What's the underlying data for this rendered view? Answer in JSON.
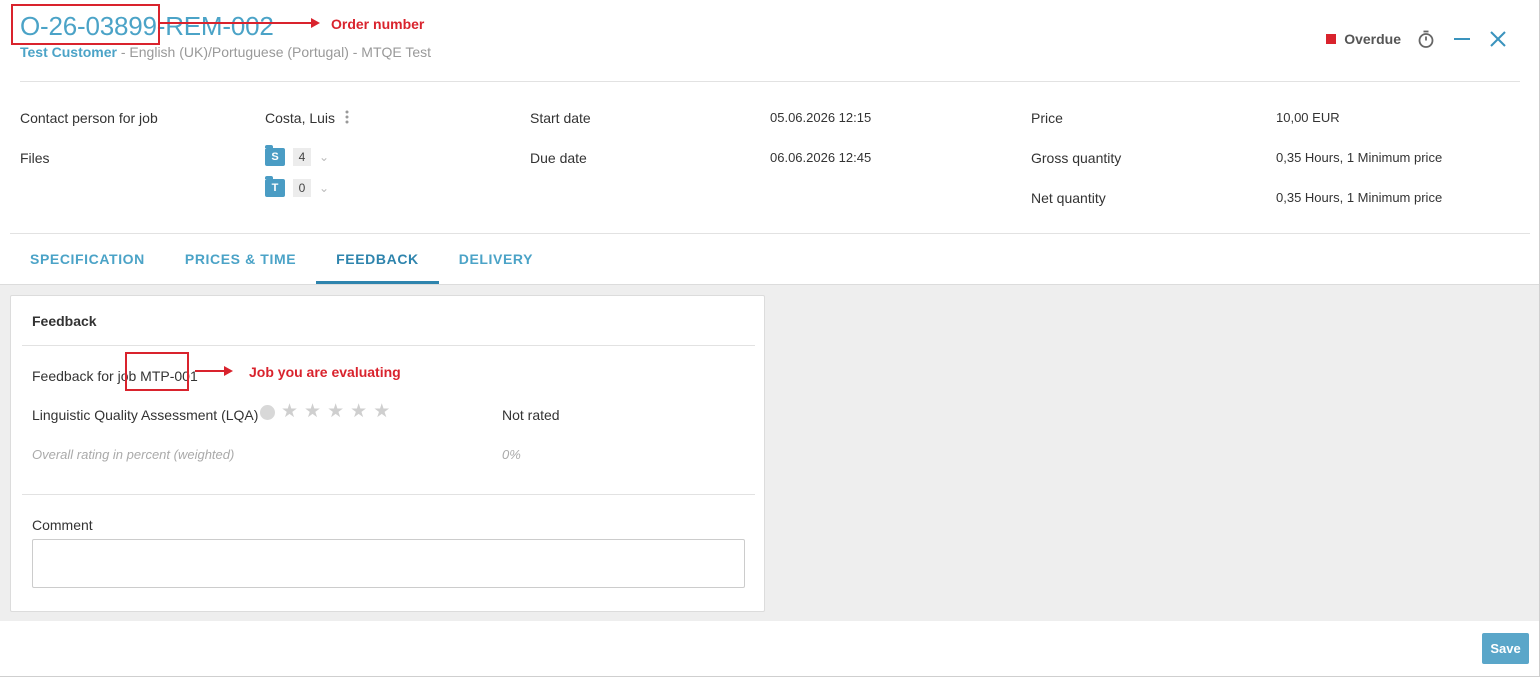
{
  "header": {
    "order_number": "O-26-03899-REM-002",
    "customer": "Test Customer",
    "subtitle_rest": " - English (UK)/Portuguese (Portugal) - MTQE Test",
    "status": "Overdue",
    "status_color": "#d9232d"
  },
  "info": {
    "contact_label": "Contact person for job",
    "contact_value": "Costa, Luis",
    "files_label": "Files",
    "files": [
      {
        "folder": "S",
        "count": "4"
      },
      {
        "folder": "T",
        "count": "0"
      }
    ],
    "start_label": "Start date",
    "start_value": "05.06.2026 12:15",
    "due_label": "Due date",
    "due_value": "06.06.2026 12:45",
    "price_label": "Price",
    "price_value": "10,00 EUR",
    "gross_label": "Gross quantity",
    "gross_value": "0,35 Hours, 1 Minimum price",
    "net_label": "Net quantity",
    "net_value": "0,35 Hours, 1 Minimum price"
  },
  "tabs": [
    {
      "label": "SPECIFICATION"
    },
    {
      "label": "PRICES & TIME"
    },
    {
      "label": "FEEDBACK"
    },
    {
      "label": "DELIVERY"
    }
  ],
  "active_tab": "FEEDBACK",
  "feedback": {
    "title": "Feedback",
    "job_prefix": "Feedback for job ",
    "job_id": "MTP-001",
    "lqa_label": "Linguistic Quality Assessment (LQA)",
    "lqa_stars_total": 5,
    "lqa_rating": 0,
    "lqa_status": "Not rated",
    "overall_label": "Overall rating in percent (weighted)",
    "overall_value": "0%",
    "comment_label": "Comment",
    "comment_value": ""
  },
  "footer": {
    "save_label": "Save",
    "save_color": "#5aa6c9"
  },
  "annotations": {
    "order_number": "Order number",
    "job_evaluating": "Job you are evaluating",
    "color": "#d9232d"
  },
  "colors": {
    "accent": "#4ba3c7",
    "tab_active": "#2e84ad"
  }
}
